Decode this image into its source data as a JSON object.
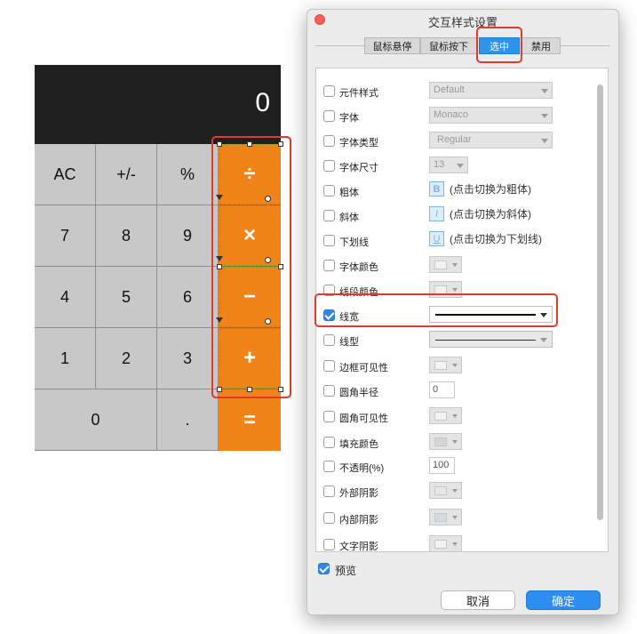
{
  "calculator": {
    "display": "0",
    "keys": [
      {
        "label": "AC"
      },
      {
        "label": "+/-"
      },
      {
        "label": "%"
      },
      {
        "label": "÷"
      },
      {
        "label": "7"
      },
      {
        "label": "8"
      },
      {
        "label": "9"
      },
      {
        "label": "×"
      },
      {
        "label": "4"
      },
      {
        "label": "5"
      },
      {
        "label": "6"
      },
      {
        "label": "−"
      },
      {
        "label": "1"
      },
      {
        "label": "2"
      },
      {
        "label": "3"
      },
      {
        "label": "+"
      },
      {
        "label": "0"
      },
      {
        "label": "."
      },
      {
        "label": "="
      }
    ],
    "colors": {
      "operator": "#f08418",
      "display_bg": "#1f1f1f",
      "key_bg": "#c8c8c8"
    }
  },
  "dialog": {
    "title": "交互样式设置",
    "tabs": [
      {
        "label": "鼠标悬停",
        "active": false
      },
      {
        "label": "鼠标按下",
        "active": false
      },
      {
        "label": "选中",
        "active": true
      },
      {
        "label": "禁用",
        "active": false
      }
    ],
    "properties": {
      "widget_style": {
        "label": "元件样式",
        "value": "Default",
        "checked": false
      },
      "font": {
        "label": "字体",
        "value": "Monaco",
        "checked": false
      },
      "font_type": {
        "label": "字体类型",
        "value": "Regular",
        "checked": false
      },
      "font_size": {
        "label": "字体尺寸",
        "value": "13",
        "checked": false
      },
      "bold": {
        "label": "粗体",
        "icon_text": "B",
        "hint": "(点击切换为粗体)",
        "checked": false
      },
      "italic": {
        "label": "斜体",
        "icon_text": "I",
        "hint": "(点击切换为斜体)",
        "checked": false
      },
      "underline": {
        "label": "下划线",
        "icon_text": "U",
        "hint": "(点击切换为下划线)",
        "checked": false
      },
      "font_color": {
        "label": "字体颜色",
        "icon": "text-color-icon",
        "checked": false
      },
      "line_color": {
        "label": "线段颜色",
        "icon": "pencil-icon",
        "checked": false
      },
      "line_width": {
        "label": "线宽",
        "checked": true
      },
      "line_style": {
        "label": "线型",
        "checked": false
      },
      "border_visibility": {
        "label": "边框可见性",
        "icon": "border-icon",
        "checked": false
      },
      "corner_radius": {
        "label": "圆角半径",
        "value": "0",
        "checked": false
      },
      "corner_visibility": {
        "label": "圆角可见性",
        "icon": "corner-icon",
        "checked": false
      },
      "fill_color": {
        "label": "填充颜色",
        "icon": "fill-icon",
        "checked": false
      },
      "opacity": {
        "label": "不透明(%)",
        "value": "100",
        "checked": false
      },
      "outer_shadow": {
        "label": "外部阴影",
        "icon": "shadow-icon",
        "checked": false
      },
      "inner_shadow": {
        "label": "内部阴影",
        "icon": "inner-shadow-icon",
        "checked": false
      },
      "text_shadow": {
        "label": "文字阴影",
        "icon": "text-shadow-icon",
        "checked": false
      }
    },
    "preview": {
      "label": "预览",
      "checked": true
    },
    "buttons": {
      "cancel": "取消",
      "ok": "确定"
    }
  },
  "colors": {
    "accent": "#2f93e8",
    "highlight": "#e03a2a"
  }
}
